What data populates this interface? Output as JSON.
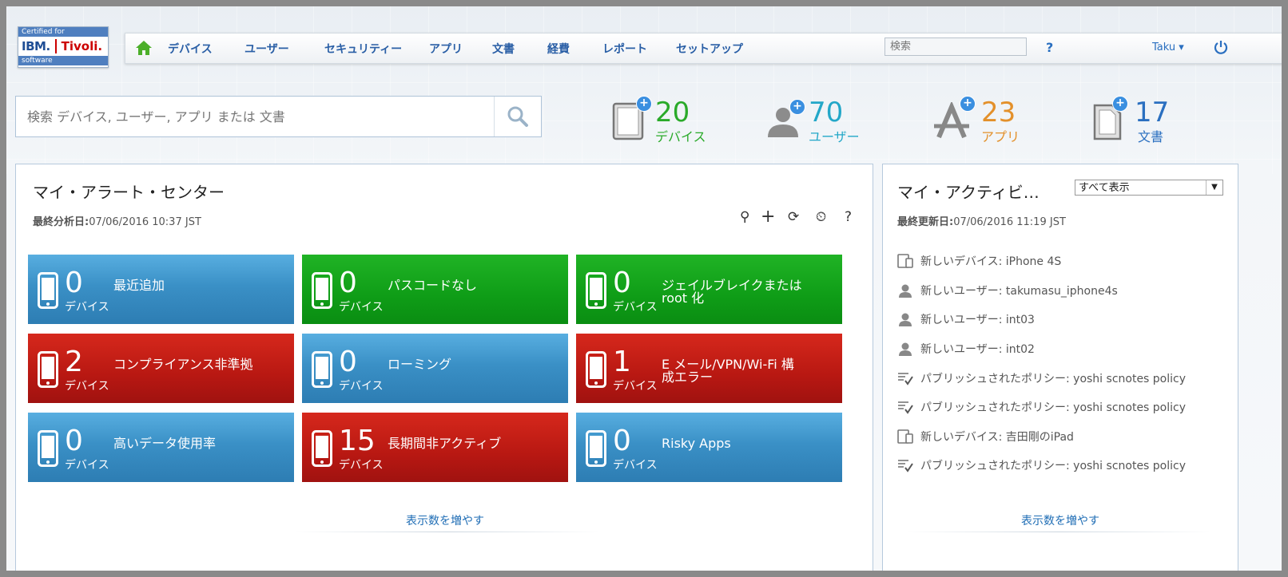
{
  "logo": {
    "top": "Certified for",
    "ibm": "IBM.",
    "tivoli": "Tivoli.",
    "bottom": "software"
  },
  "nav": {
    "items": [
      "デバイス",
      "ユーザー",
      "セキュリティー",
      "アプリ",
      "文書",
      "経費",
      "レポート",
      "セットアップ"
    ],
    "search_placeholder": "検索",
    "help": "?",
    "user": "Taku ▾"
  },
  "search": {
    "placeholder": "検索 デバイス, ユーザー, アプリ または 文書"
  },
  "stats": [
    {
      "name": "devices",
      "count": "20",
      "label": "デバイス",
      "color": "#2aaa2a"
    },
    {
      "name": "users",
      "count": "70",
      "label": "ユーザー",
      "color": "#23a7c8"
    },
    {
      "name": "apps",
      "count": "23",
      "label": "アプリ",
      "color": "#e3902a"
    },
    {
      "name": "docs",
      "count": "17",
      "label": "文書",
      "color": "#2a6fc0"
    }
  ],
  "alerts": {
    "title": "マイ・アラート・センター",
    "sub_label": "最終分析日:",
    "sub_value": "07/06/2016 10:37 JST",
    "tools": [
      "⚲",
      "+",
      "⟳",
      "⏲",
      "?"
    ],
    "tiles": [
      {
        "count": "0",
        "unit": "デバイス",
        "label": "最近追加",
        "color": "blue"
      },
      {
        "count": "0",
        "unit": "デバイス",
        "label": "パスコードなし",
        "color": "green"
      },
      {
        "count": "0",
        "unit": "デバイス",
        "label": "ジェイルブレイクまたは root 化",
        "color": "green"
      },
      {
        "count": "2",
        "unit": "デバイス",
        "label": "コンプライアンス非準拠",
        "color": "red"
      },
      {
        "count": "0",
        "unit": "デバイス",
        "label": "ローミング",
        "color": "blue"
      },
      {
        "count": "1",
        "unit": "デバイス",
        "label": "E メール/VPN/Wi-Fi 構成エラー",
        "color": "red"
      },
      {
        "count": "0",
        "unit": "デバイス",
        "label": "高いデータ使用率",
        "color": "blue"
      },
      {
        "count": "15",
        "unit": "デバイス",
        "label": "長期間非アクティブ",
        "color": "red"
      },
      {
        "count": "0",
        "unit": "デバイス",
        "label": "Risky Apps",
        "color": "blue"
      }
    ],
    "more": "表示数を増やす"
  },
  "activity": {
    "title": "マイ・アクティビ…",
    "filter": "すべて表示",
    "sub_label": "最終更新日:",
    "sub_value": "07/06/2016 11:19 JST",
    "items": [
      {
        "icon": "device-icon",
        "text": "新しいデバイス: iPhone 4S"
      },
      {
        "icon": "user-icon",
        "text": "新しいユーザー: takumasu_iphone4s"
      },
      {
        "icon": "user-icon",
        "text": "新しいユーザー: int03"
      },
      {
        "icon": "user-icon",
        "text": "新しいユーザー: int02"
      },
      {
        "icon": "policy-icon",
        "text": "パブリッシュされたポリシー: yoshi scnotes policy"
      },
      {
        "icon": "policy-icon",
        "text": "パブリッシュされたポリシー: yoshi scnotes policy"
      },
      {
        "icon": "device-icon",
        "text": "新しいデバイス: 吉田剛のiPad"
      },
      {
        "icon": "policy-icon",
        "text": "パブリッシュされたポリシー: yoshi scnotes policy"
      }
    ],
    "more": "表示数を増やす"
  }
}
